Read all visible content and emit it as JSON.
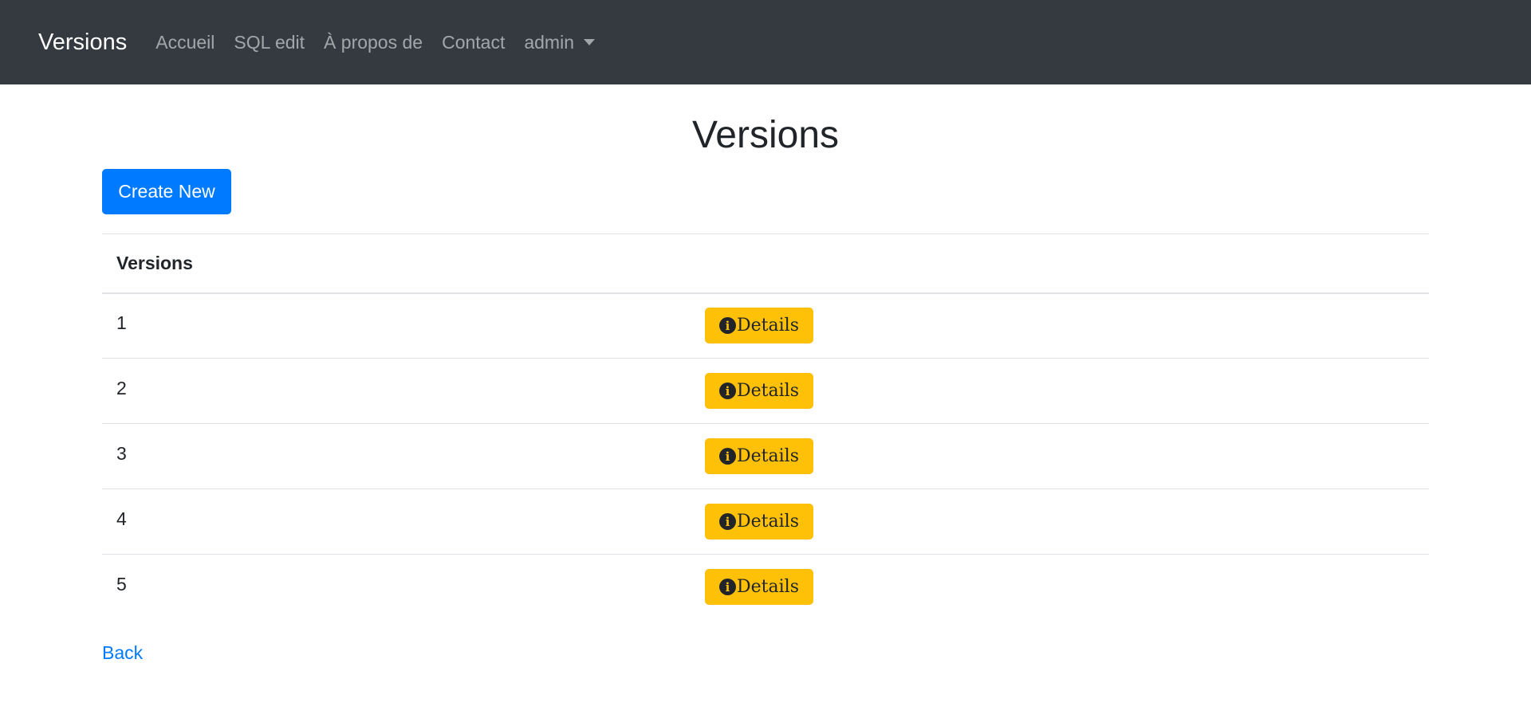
{
  "navbar": {
    "brand": "Versions",
    "links": [
      {
        "label": "Accueil"
      },
      {
        "label": "SQL edit"
      },
      {
        "label": "À propos de"
      },
      {
        "label": "Contact"
      }
    ],
    "user_menu": "admin"
  },
  "page": {
    "title": "Versions",
    "create_label": "Create New",
    "back_label": "Back"
  },
  "table": {
    "header": "Versions",
    "details_label": "Details",
    "rows": [
      {
        "version": "1"
      },
      {
        "version": "2"
      },
      {
        "version": "3"
      },
      {
        "version": "4"
      },
      {
        "version": "5"
      }
    ]
  },
  "colors": {
    "navbar_bg": "#343a40",
    "primary": "#007bff",
    "warning": "#ffc107"
  },
  "icons": {
    "details": "info-circle-icon",
    "dropdown": "caret-down-icon"
  }
}
